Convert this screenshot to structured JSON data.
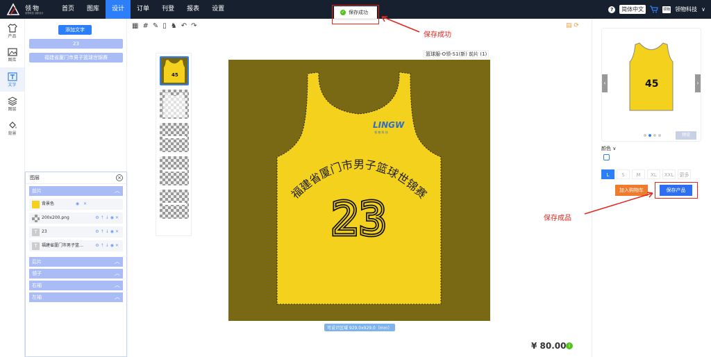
{
  "brand": {
    "name": "领物",
    "tagline": "领物科技 创新设计"
  },
  "nav": [
    "首页",
    "图库",
    "设计",
    "订单",
    "刊登",
    "报表",
    "设置"
  ],
  "header": {
    "help": "?",
    "language": "简体中文",
    "avatar_text": "领物",
    "company": "领物科技",
    "chevron": "∨"
  },
  "toast": {
    "text": "保存成功",
    "check": "✓"
  },
  "annotations": {
    "save_success": "保存成功",
    "save_product": "保存成品"
  },
  "sidebar": [
    {
      "icon": "shirt-icon",
      "label": "产品"
    },
    {
      "icon": "image-icon",
      "label": "图库"
    },
    {
      "icon": "text-icon",
      "label": "文字"
    },
    {
      "icon": "layers-icon",
      "label": "图层"
    },
    {
      "icon": "fill-icon",
      "label": "背景"
    }
  ],
  "text_panel": {
    "add_text": "添加文字",
    "fields": [
      "23",
      "福建省厦门市男子篮球世锦赛"
    ]
  },
  "layers": {
    "title": "图层",
    "close": "×",
    "groups": [
      {
        "name": "前片",
        "items": [
          {
            "name": "背景色",
            "swatch": "#f4d11d"
          },
          {
            "name": "200x200.png"
          },
          {
            "name": "23"
          },
          {
            "name": "福建省厦门市男子篮…"
          }
        ]
      },
      {
        "name": "后片"
      },
      {
        "name": "领子"
      },
      {
        "name": "右袖"
      },
      {
        "name": "左袖"
      }
    ]
  },
  "toolbar": [
    "▦",
    "#",
    "✎",
    "▯",
    "♞",
    "↶",
    "↷"
  ],
  "toolbar_right": "▤ ⟳",
  "canvas": {
    "label": "篮球服-O领-S1(新) 前片 (1)",
    "hint": "可设计区域 929.0x929.0（mm）",
    "background": "#7a6914",
    "jersey_color": "#f4d11d",
    "text_arc": "福建省厦门市男子篮球世锦赛",
    "number": "23",
    "logo_text": "LINGW",
    "logo_sub": "领 物 科 技"
  },
  "price": "¥ 80.00",
  "price_icon": "i",
  "right": {
    "preview_number": "45",
    "color_label": "颜色",
    "sizes": [
      "L",
      "S",
      "M",
      "XL",
      "XXL",
      "更多"
    ],
    "selected_size": "L",
    "add_cart": "加入购物车",
    "save_product": "保存产品",
    "preview_btn": "预览",
    "arrow_left": "‹",
    "arrow_right": "›"
  }
}
